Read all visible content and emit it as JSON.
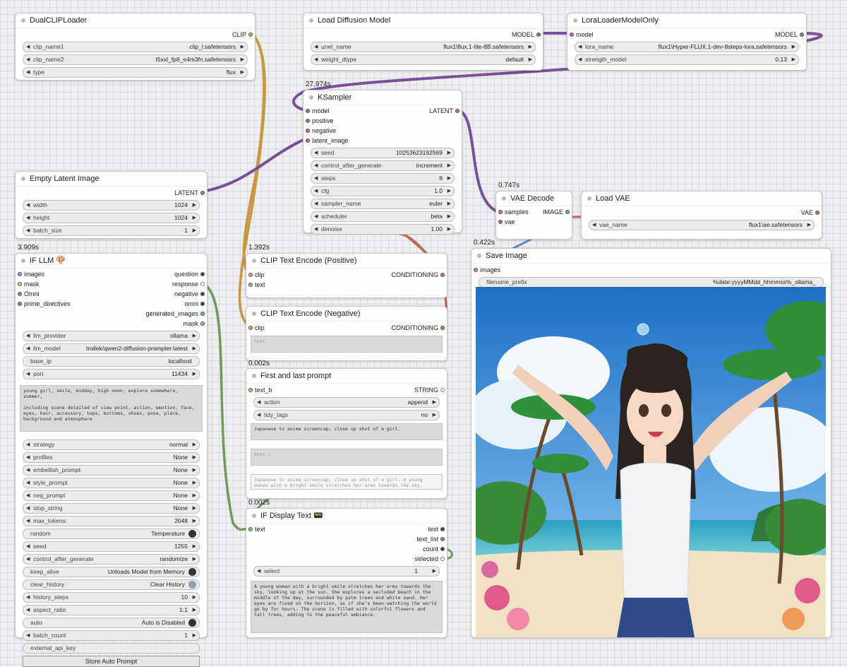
{
  "colors": {
    "model_wire": "#7a4f9a",
    "clip_wire": "#c89640",
    "cond_wire": "#b86f58",
    "string_wire": "#6f9a5a",
    "latent_wire": "#7a4f9a",
    "vae_wire": "#c87060",
    "image_wire": "#5a8ac8"
  },
  "dualclip": {
    "title": "DualCLIPLoader",
    "out": "CLIP",
    "w1_label": "clip_name1",
    "w1_value": "clip_l.safetensors",
    "w2_label": "clip_name2",
    "w2_value": "t5xxl_fp8_e4m3fn.safetensors",
    "w3_label": "type",
    "w3_value": "flux"
  },
  "diffusion": {
    "title": "Load Diffusion Model",
    "out": "MODEL",
    "w1_label": "unet_name",
    "w1_value": "flux1\\flux.1-lite-8B.safetensors",
    "w2_label": "weight_dtype",
    "w2_value": "default"
  },
  "lora": {
    "title": "LoraLoaderModelOnly",
    "in": "model",
    "out": "MODEL",
    "w1_label": "lora_name",
    "w1_value": "flux1\\Hyper-FLUX.1-dev-8steps-lora.safetensors",
    "w2_label": "strength_model",
    "w2_value": "0.13"
  },
  "ksampler": {
    "badge": "27.974s",
    "title": "KSampler",
    "inputs": [
      "model",
      "positive",
      "negative",
      "latent_image"
    ],
    "out": "LATENT",
    "widgets": [
      {
        "label": "seed",
        "value": "10253623192569"
      },
      {
        "label": "control_after_generate",
        "value": "increment"
      },
      {
        "label": "steps",
        "value": "8"
      },
      {
        "label": "cfg",
        "value": "1.0"
      },
      {
        "label": "sampler_name",
        "value": "euler"
      },
      {
        "label": "scheduler",
        "value": "beta"
      },
      {
        "label": "denoise",
        "value": "1.00"
      }
    ]
  },
  "latent": {
    "title": "Empty Latent Image",
    "out": "LATENT",
    "w1_label": "width",
    "w1_value": "1024",
    "w2_label": "height",
    "w2_value": "1024",
    "w3_label": "batch_size",
    "w3_value": "1"
  },
  "vaedecode": {
    "badge": "0.747s",
    "title": "VAE Decode",
    "in1": "samples",
    "in2": "vae",
    "out": "IMAGE"
  },
  "loadvae": {
    "title": "Load VAE",
    "out": "VAE",
    "w1_label": "vae_name",
    "w1_value": "flux1\\ae.safetensors"
  },
  "saveimage": {
    "badge": "0.422s",
    "title": "Save Image",
    "in": "images",
    "w1_label": "filename_prefix",
    "w1_value": "%date:yyyyMMdd_hhmmss%_ollama_"
  },
  "clippos": {
    "badge": "1.392s",
    "title": "CLIP Text Encode (Positive)",
    "in1": "clip",
    "in2": "text",
    "out": "CONDITIONING"
  },
  "clipneg": {
    "title": "CLIP Text Encode (Negative)",
    "in1": "clip",
    "out": "CONDITIONING",
    "text_placeholder": "text"
  },
  "firstlast": {
    "badge": "0.002s",
    "title": "First and last prompt",
    "in": "text_b",
    "out": "STRING",
    "w1_label": "action",
    "w1_value": "append",
    "w2_label": "tidy_tags",
    "w2_value": "no",
    "text_a": "Japanese tv anime screencap, close up shot of a girl.",
    "text_c_placeholder": "text_c",
    "preview": "Japanese tv anime screencap, close up shot of a girl. A young woman with a bright smile stretches her arms towards the sky, looking up at the sun. She explores a secluded beach in the middle of the day, surrounded by palm"
  },
  "display": {
    "badge": "0.002s",
    "title": "IF Display Text",
    "title_icon": "📟",
    "in": "text",
    "outs": [
      "text",
      "text_list",
      "count",
      "selected"
    ],
    "w1_label": "select",
    "w1_value": "1",
    "text": "A young woman with a bright smile stretches her arms towards the sky, looking up at the sun. She explores a secluded beach in the middle of the day, surrounded by palm trees and white sand. Her eyes are fixed on the horizon, as if she's been watching the world go by for hours. The scene is filled with colorful flowers and tall trees, adding to the peaceful ambiance."
  },
  "ifllm": {
    "badge": "3.909s",
    "title": "IF LLM",
    "title_icon": "🍄",
    "inputs": [
      "images",
      "mask",
      "Omni",
      "prime_directives"
    ],
    "outputs": [
      "question",
      "response",
      "negative",
      "omni",
      "generated_images",
      "mask"
    ],
    "top_widgets": [
      {
        "label": "llm_provider",
        "value": "ollama"
      },
      {
        "label": "llm_model",
        "value": "trollek/qwen2-diffusion-prompter:latest"
      },
      {
        "label": "base_ip",
        "value": "localhost"
      },
      {
        "label": "port",
        "value": "11434"
      }
    ],
    "prompt": "young girl, smile, midday, high noon, explore somewhere, summer,\n\nincluding scene detailed of view point, action, emotion, face, eyes, hair, accessory, tops, bottoms, shoes, pose, place, background and atmosphere",
    "widgets": [
      {
        "label": "strategy",
        "value": "normal"
      },
      {
        "label": "profiles",
        "value": "None"
      },
      {
        "label": "embellish_prompt",
        "value": "None"
      },
      {
        "label": "style_prompt",
        "value": "None"
      },
      {
        "label": "neg_prompt",
        "value": "None"
      },
      {
        "label": "stop_string",
        "value": "None"
      },
      {
        "label": "max_tokens",
        "value": "2048"
      },
      {
        "label": "random",
        "value": "Temperature"
      },
      {
        "label": "seed",
        "value": "1255"
      },
      {
        "label": "control_after_generate",
        "value": "randomize"
      },
      {
        "label": "keep_alive",
        "value": "Unloads Model from Memory"
      },
      {
        "label": "clear_history",
        "value": "Clear History"
      },
      {
        "label": "history_steps",
        "value": "10"
      },
      {
        "label": "aspect_ratio",
        "value": "1:1"
      },
      {
        "label": "auto",
        "value": "Auto is Disabled"
      },
      {
        "label": "batch_count",
        "value": "1"
      },
      {
        "label": "external_api_key",
        "value": ""
      }
    ],
    "button": "Store Auto Prompt"
  }
}
